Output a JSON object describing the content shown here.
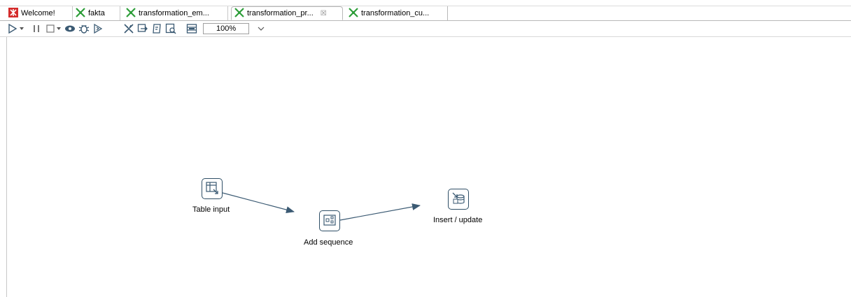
{
  "tabs": [
    {
      "label": "Welcome!",
      "icon": "welcome-icon"
    },
    {
      "label": "fakta",
      "icon": "transformation-icon"
    },
    {
      "label": "transformation_em...",
      "icon": "transformation-icon"
    },
    {
      "label": "transformation_pr...",
      "icon": "transformation-icon",
      "active": true,
      "close": "☒"
    },
    {
      "label": "transformation_cu...",
      "icon": "transformation-icon"
    }
  ],
  "toolbar": {
    "zoom_value": "100%",
    "buttons": [
      "run-icon",
      "run-dropdown-icon",
      "pause-icon",
      "stop-icon",
      "stop-dropdown-icon",
      "preview-icon",
      "debug-icon",
      "replay-icon",
      "verify-icon",
      "impact-icon",
      "sql-icon",
      "explore-db-icon",
      "show-results-icon"
    ]
  },
  "steps": [
    {
      "label": "Table input",
      "icon": "table-input-icon"
    },
    {
      "label": "Add sequence",
      "icon": "add-sequence-icon"
    },
    {
      "label": "Insert / update",
      "icon": "insert-update-icon"
    }
  ],
  "colors": {
    "hop": "#3b5a73",
    "step_border": "#2f4f66",
    "kettle_green": "#2e9e3a",
    "welcome_red": "#d42b2b"
  }
}
